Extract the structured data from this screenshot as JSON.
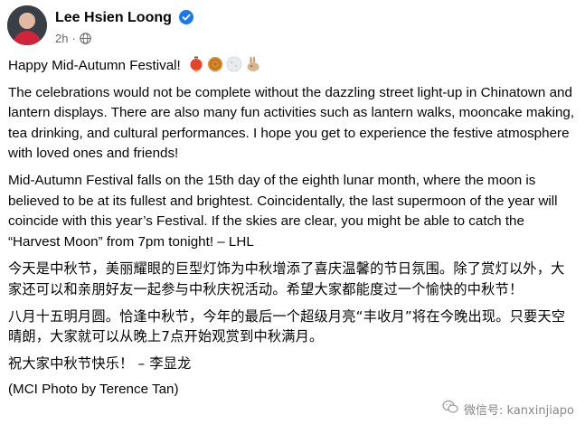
{
  "post": {
    "author": "Lee Hsien Loong",
    "time": "2h",
    "meta_separator": "·",
    "greeting": "Happy Mid-Autumn Festival!",
    "emojis": [
      "lantern",
      "mooncake",
      "full-moon",
      "rabbit"
    ],
    "paragraphs": [
      "The celebrations would not be complete without the dazzling street light-up in Chinatown and lantern displays. There are also many fun activities such as lantern walks, mooncake making, tea drinking, and cultural performances. I hope you get to experience the festive atmosphere with loved ones and friends!",
      "Mid-Autumn Festival falls on the 15th day of the eighth lunar month, where the moon is believed to be at its fullest and brightest. Coincidentally, the last supermoon of the year will coincide with this year’s Festival. If the skies are clear, you might be able to catch the “Harvest Moon” from 7pm tonight! – LHL",
      "今天是中秋节，美丽耀眼的巨型灯饰为中秋增添了喜庆温馨的节日氛围。除了赏灯以外，大家还可以和亲朋好友一起参与中秋庆祝活动。希望大家都能度过一个愉快的中秋节！",
      "八月十五明月圆。恰逢中秋节，今年的最后一个超级月亮“丰收月”将在今晚出现。只要天空晴朗，大家就可以从晚上7点开始观赏到中秋满月。",
      "祝大家中秋节快乐！ – 李显龙"
    ],
    "credit": "(MCI Photo by Terence Tan)"
  },
  "watermark": {
    "text": "微信号: kanxinjiapo"
  },
  "colors": {
    "verified": "#1877f2",
    "meta": "#65676b",
    "text": "#050505"
  }
}
